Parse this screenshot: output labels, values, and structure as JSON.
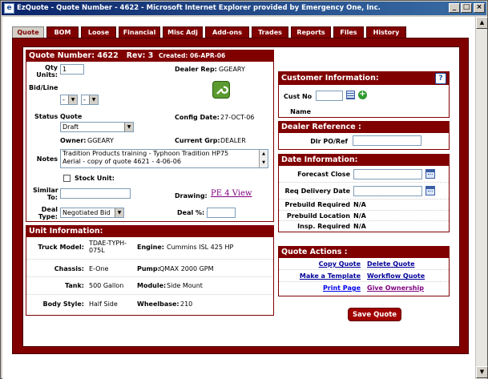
{
  "window": {
    "title": "EzQuote - Quote Number - 4622 - Microsoft Internet Explorer provided by Emergency One, Inc."
  },
  "tabs": [
    {
      "label": "Quote",
      "active": true
    },
    {
      "label": "BOM"
    },
    {
      "label": "Loose"
    },
    {
      "label": "Financial"
    },
    {
      "label": "Misc Adj"
    },
    {
      "label": "Add-ons"
    },
    {
      "label": "Trades"
    },
    {
      "label": "Reports"
    },
    {
      "label": "Files"
    },
    {
      "label": "History"
    }
  ],
  "quote": {
    "header_number": "Quote Number: 4622",
    "header_rev": "Rev: 3",
    "header_created": "Created: 06-APR-06",
    "qty_label": "Qty Units:",
    "qty_value": "1",
    "bidline_label": "Bid/Line",
    "bidline_sel1": "-",
    "bidline_sel2": "-",
    "dealer_rep_label": "Dealer Rep:",
    "dealer_rep_value": "GGEARY",
    "status_label": "Status",
    "status_sub": "Quote",
    "status_value": "Draft",
    "config_date_label": "Config Date:",
    "config_date_value": "27-OCT-06",
    "owner_label": "Owner:",
    "owner_value": "GGEARY",
    "current_grp_label": "Current Grp:",
    "current_grp_value": "DEALER",
    "notes_label": "Notes",
    "notes_line1": "Tradition Products training - Typhoon Tradition HP75",
    "notes_line2": "Aerial - copy of quote 4621 - 4-06-06",
    "stock_unit_label": "Stock Unit:",
    "similar_to_label": "Similar To:",
    "similar_to_value": "",
    "drawing_label": "Drawing:",
    "drawing_link": "PE 4 View",
    "deal_type_label": "Deal Type:",
    "deal_type_value": "Negotiated Bid",
    "deal_pct_label": "Deal %:",
    "deal_pct_value": ""
  },
  "unit": {
    "header": "Unit Information:",
    "truck_model_label": "Truck Model:",
    "truck_model_line1": "TDAE-TYPH-",
    "truck_model_line2": "075L",
    "engine_label": "Engine:",
    "engine_value": "Cummins ISL 425 HP",
    "chassis_label": "Chassis:",
    "chassis_value": "E-One",
    "pump_label": "Pump:",
    "pump_value": "QMAX 2000 GPM",
    "tank_label": "Tank:",
    "tank_value": "500 Gallon",
    "module_label": "Module:",
    "module_value": "Side Mount",
    "body_style_label": "Body Style:",
    "body_style_value": "Half Side",
    "wheelbase_label": "Wheelbase:",
    "wheelbase_value": "210"
  },
  "customer": {
    "header": "Customer Information:",
    "cust_no_label": "Cust No",
    "cust_no_value": "",
    "name_label": "Name",
    "name_value": ""
  },
  "dealer_ref": {
    "header": "Dealer Reference :",
    "dlr_po_label": "Dlr PO/Ref",
    "dlr_po_value": ""
  },
  "dates": {
    "header": "Date Information:",
    "forecast_close_label": "Forecast Close",
    "forecast_close_value": "",
    "req_delivery_label": "Req Delivery Date",
    "req_delivery_value": "",
    "prebuild_required_label": "Prebuild Required",
    "prebuild_required_value": "N/A",
    "prebuild_location_label": "Prebuild Location",
    "prebuild_location_value": "N/A",
    "insp_required_label": "Insp. Required",
    "insp_required_value": "N/A"
  },
  "actions": {
    "header": "Quote Actions :",
    "copy_quote": "Copy Quote",
    "delete_quote": "Delete Quote",
    "make_template": "Make a Template",
    "workflow_quote": "Workflow Quote",
    "print_page": "Print Page",
    "give_ownership": "Give Ownership",
    "save_quote": "Save Quote"
  },
  "colors": {
    "maroon": "#800000",
    "link_blue": "#000099",
    "title_blue": "#0a246a"
  }
}
